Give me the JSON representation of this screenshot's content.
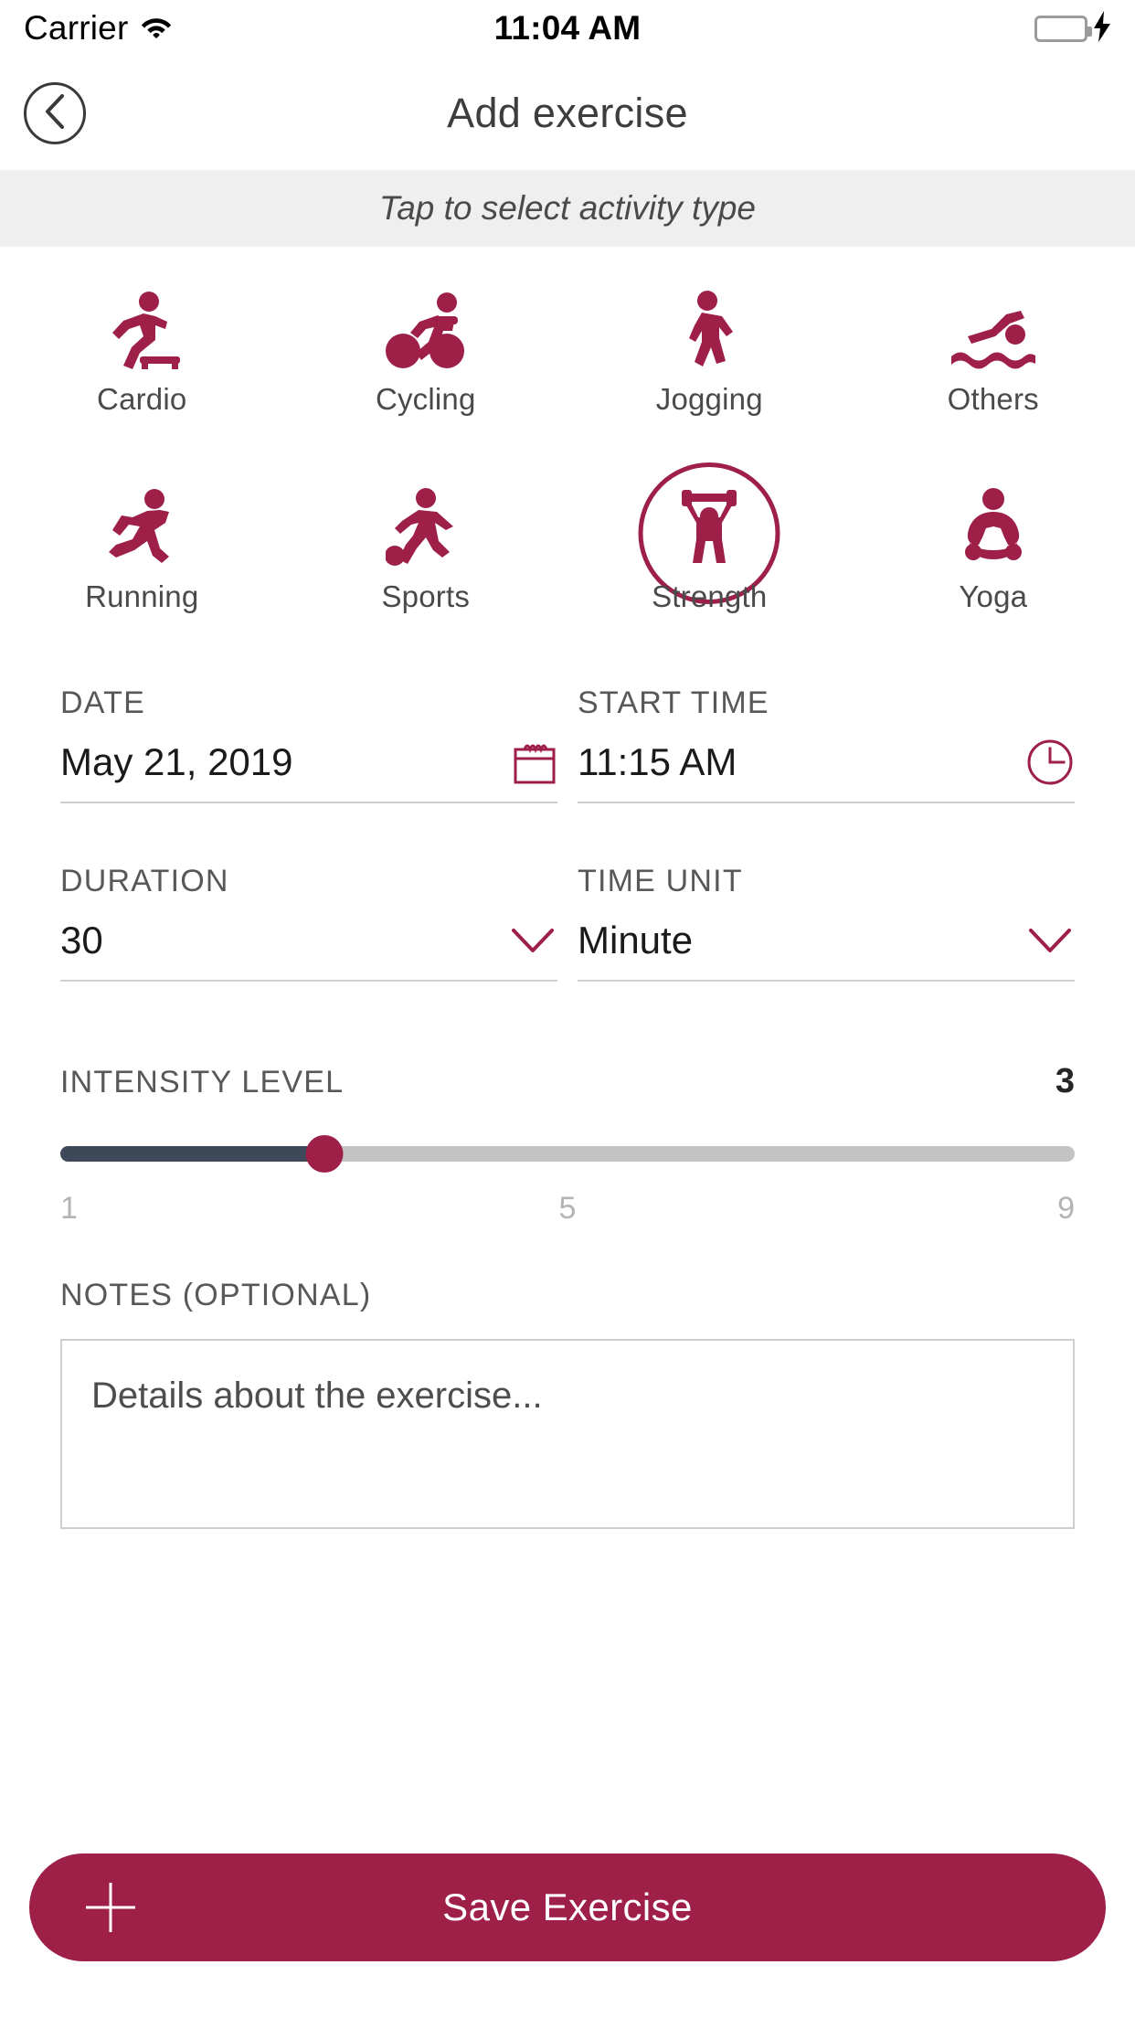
{
  "status_bar": {
    "carrier": "Carrier",
    "time": "11:04 AM",
    "wifi_icon": "wifi-icon",
    "battery_icon": "battery-icon",
    "charging_icon": "lightning-bolt-icon",
    "battery_color": "#4cd364"
  },
  "nav": {
    "title": "Add exercise",
    "back_icon": "chevron-left-icon"
  },
  "hint": {
    "text": "Tap to select activity type"
  },
  "theme": {
    "accent": "#9e1f47",
    "slider_fill": "#3d4859",
    "slider_track": "#c3c3c3"
  },
  "activities": {
    "selected": "Strength",
    "rows": [
      [
        {
          "label": "Cardio",
          "icon": "cardio-step-icon"
        },
        {
          "label": "Cycling",
          "icon": "cycling-icon"
        },
        {
          "label": "Jogging",
          "icon": "jogging-icon"
        },
        {
          "label": "Others",
          "icon": "swimming-icon"
        }
      ],
      [
        {
          "label": "Running",
          "icon": "running-icon"
        },
        {
          "label": "Sports",
          "icon": "sports-soccer-icon"
        },
        {
          "label": "Strength",
          "icon": "weightlifting-icon"
        },
        {
          "label": "Yoga",
          "icon": "yoga-lotus-icon"
        }
      ]
    ]
  },
  "fields": {
    "date": {
      "label": "DATE",
      "value": "May 21, 2019",
      "icon": "calendar-icon"
    },
    "start_time": {
      "label": "START TIME",
      "value": "11:15 AM",
      "icon": "clock-icon"
    },
    "duration": {
      "label": "DURATION",
      "value": "30",
      "icon": "chevron-down-icon"
    },
    "time_unit": {
      "label": "TIME UNIT",
      "value": "Minute",
      "icon": "chevron-down-icon"
    }
  },
  "intensity": {
    "label": "INTENSITY LEVEL",
    "value": "3",
    "min": "1",
    "mid": "5",
    "max": "9",
    "fill_percent": 26
  },
  "notes": {
    "label": "NOTES (OPTIONAL)",
    "placeholder": "Details about the exercise..."
  },
  "save": {
    "label": "Save Exercise",
    "icon": "plus-icon"
  }
}
